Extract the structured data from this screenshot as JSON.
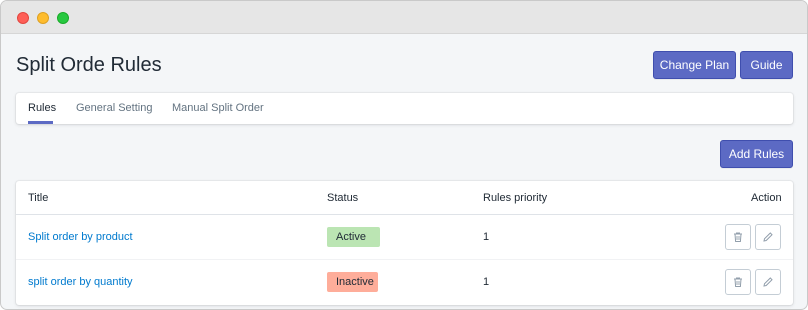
{
  "window": {
    "title": ""
  },
  "page": {
    "title": "Split Orde Rules"
  },
  "header_buttons": {
    "change_plan": "Change Plan",
    "guide": "Guide"
  },
  "tabs": [
    {
      "label": "Rules",
      "active": true
    },
    {
      "label": "General Setting",
      "active": false
    },
    {
      "label": "Manual Split Order",
      "active": false
    }
  ],
  "actions": {
    "add_rules": "Add Rules"
  },
  "table": {
    "columns": {
      "title": "Title",
      "status": "Status",
      "priority": "Rules priority",
      "action": "Action"
    },
    "rows": [
      {
        "title": "Split order by product",
        "status": "Active",
        "priority": "1"
      },
      {
        "title": "split order by quantity",
        "status": "Inactive",
        "priority": "1"
      }
    ]
  },
  "colors": {
    "primary": "#5c6ac4",
    "link": "#007ace",
    "active_badge": "#bbe5b3",
    "inactive_badge": "#fead9a"
  },
  "icons": {
    "delete": "trash-icon",
    "edit": "pencil-icon"
  }
}
